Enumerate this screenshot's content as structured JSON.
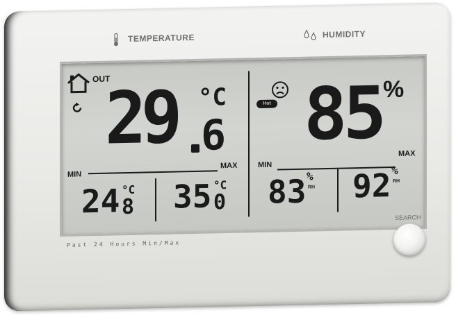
{
  "header": {
    "temperature_label": "TEMPERATURE",
    "humidity_label": "HUMIDITY"
  },
  "display": {
    "location_label": "OUT",
    "temperature": {
      "integer": "29",
      "decimal": "6",
      "unit": "°C"
    },
    "humidity": {
      "value": "85",
      "unit": "%"
    },
    "comfort_badge": "Hot",
    "min_label": "MIN",
    "max_label": "MAX",
    "temp_min": {
      "integer": "24",
      "decimal": "8",
      "unit": "°C"
    },
    "temp_max": {
      "integer": "35",
      "decimal": "0",
      "unit": "°C"
    },
    "hum_min": {
      "value": "83",
      "unit": "%",
      "sub": "RH"
    },
    "hum_max": {
      "value": "92",
      "unit": "%",
      "sub": "RH"
    }
  },
  "footer": {
    "caption": "Past 24 Hours Min/Max",
    "search_label": "SEARCH"
  },
  "colors": {
    "lcd_background": "#c8cac6",
    "segment": "#1a1a1a",
    "device_body": "#ececea"
  }
}
